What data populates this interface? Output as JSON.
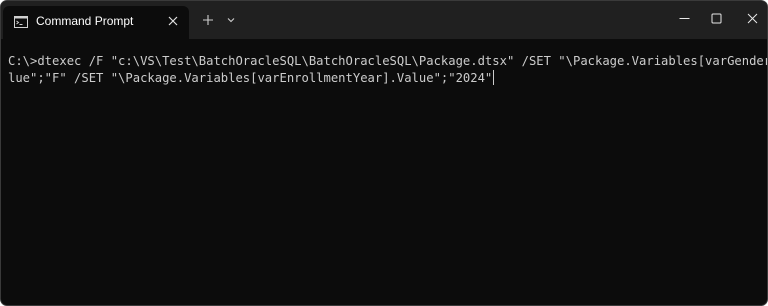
{
  "window": {
    "tab_title": "Command Prompt",
    "icons": {
      "tab": "cmd-icon",
      "tab_close": "close-icon",
      "new_tab": "plus-icon",
      "dropdown": "chevron-down-icon",
      "minimize": "minimize-icon",
      "maximize": "maximize-icon",
      "close": "close-icon"
    }
  },
  "terminal": {
    "lines": [
      "C:\\>dtexec /F \"c:\\VS\\Test\\BatchOracleSQL\\BatchOracleSQL\\Package.dtsx\" /SET \"\\Package.Variables[varGender].Va",
      "lue\";\"F\" /SET \"\\Package.Variables[varEnrollmentYear].Value\";\"2024\""
    ]
  },
  "colors": {
    "titlebar": "#202020",
    "terminal_background": "#0c0c0c",
    "terminal_text": "#cccccc"
  }
}
